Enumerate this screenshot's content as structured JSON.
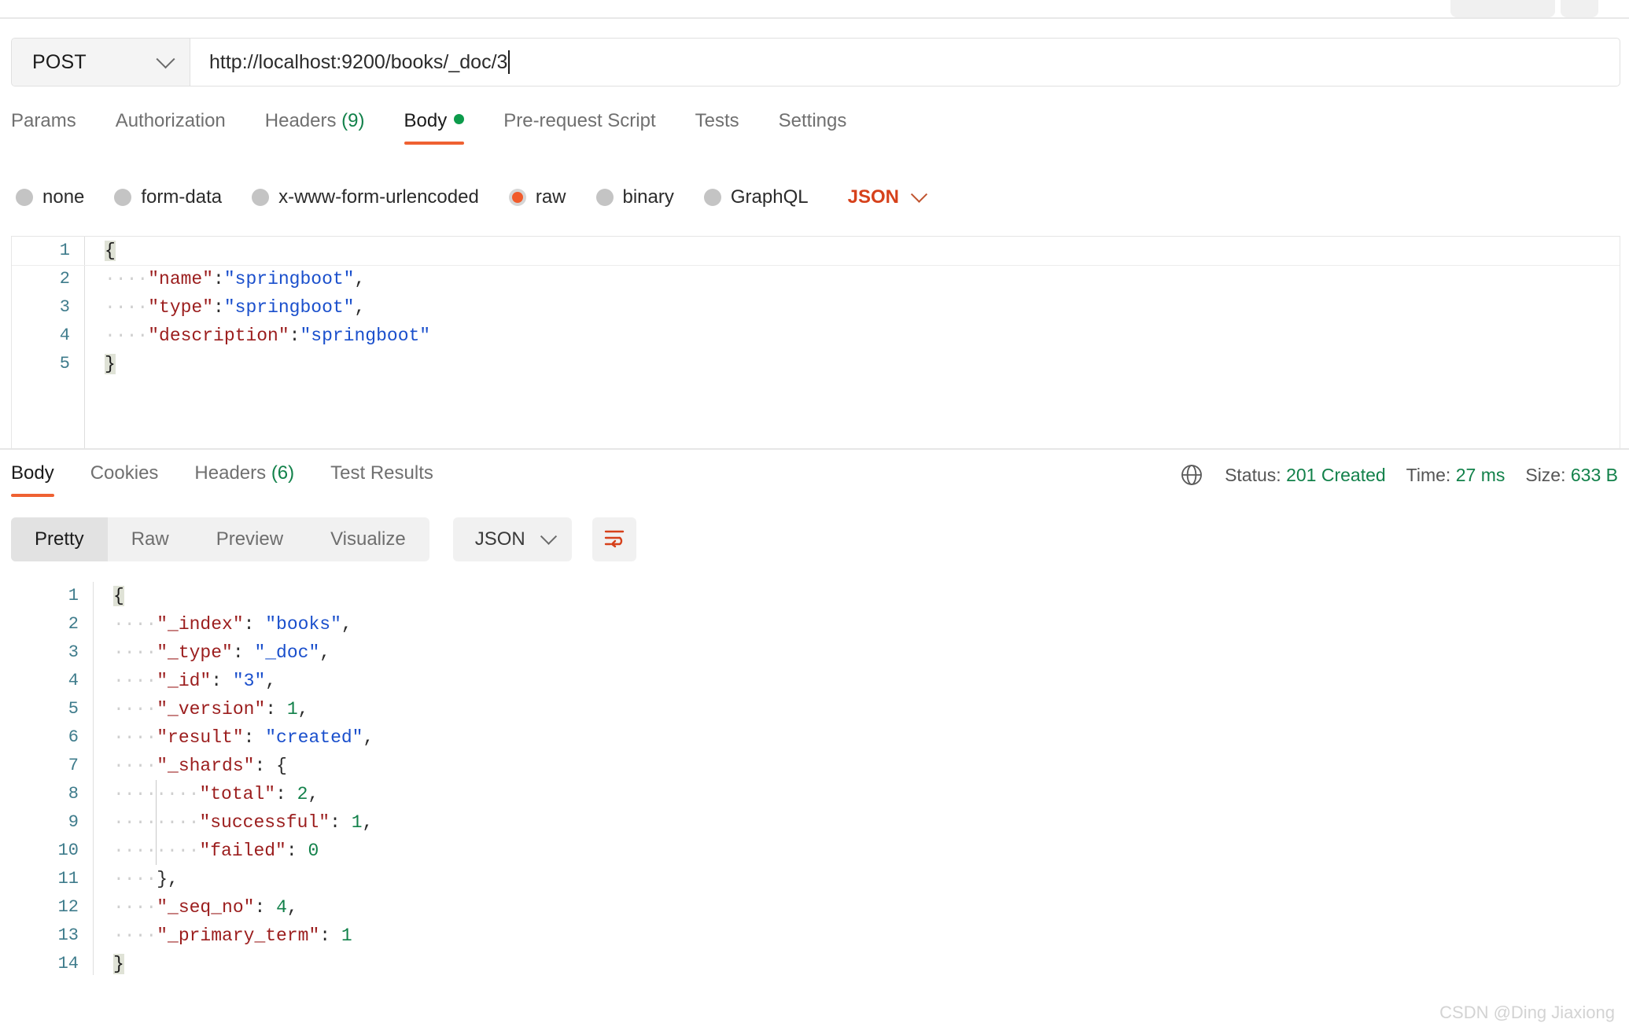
{
  "request": {
    "method": "POST",
    "url": "http://localhost:9200/books/_doc/3",
    "tabs": [
      {
        "label": "Params",
        "active": false
      },
      {
        "label": "Authorization",
        "active": false
      },
      {
        "label": "Headers",
        "count": "(9)",
        "active": false
      },
      {
        "label": "Body",
        "active": true,
        "dot": true
      },
      {
        "label": "Pre-request Script",
        "active": false
      },
      {
        "label": "Tests",
        "active": false
      },
      {
        "label": "Settings",
        "active": false
      }
    ],
    "body_modes": [
      {
        "label": "none",
        "selected": false
      },
      {
        "label": "form-data",
        "selected": false
      },
      {
        "label": "x-www-form-urlencoded",
        "selected": false
      },
      {
        "label": "raw",
        "selected": true
      },
      {
        "label": "binary",
        "selected": false
      },
      {
        "label": "GraphQL",
        "selected": false
      }
    ],
    "raw_format": "JSON",
    "body_lines": [
      {
        "n": "1",
        "text": "{"
      },
      {
        "n": "2",
        "text": "    \"name\":\"springboot\","
      },
      {
        "n": "3",
        "text": "    \"type\":\"springboot\","
      },
      {
        "n": "4",
        "text": "    \"description\":\"springboot\""
      },
      {
        "n": "5",
        "text": "}"
      }
    ]
  },
  "response": {
    "tabs": [
      {
        "label": "Body",
        "active": true
      },
      {
        "label": "Cookies",
        "active": false
      },
      {
        "label": "Headers",
        "count": "(6)",
        "active": false
      },
      {
        "label": "Test Results",
        "active": false
      }
    ],
    "status_label": "Status:",
    "status_value": "201 Created",
    "time_label": "Time:",
    "time_value": "27 ms",
    "size_label": "Size:",
    "size_value": "633 B",
    "views": [
      {
        "label": "Pretty",
        "active": true
      },
      {
        "label": "Raw",
        "active": false
      },
      {
        "label": "Preview",
        "active": false
      },
      {
        "label": "Visualize",
        "active": false
      }
    ],
    "format": "JSON",
    "body_lines": [
      {
        "n": "1",
        "text": "{"
      },
      {
        "n": "2",
        "text": "    \"_index\": \"books\","
      },
      {
        "n": "3",
        "text": "    \"_type\": \"_doc\","
      },
      {
        "n": "4",
        "text": "    \"_id\": \"3\","
      },
      {
        "n": "5",
        "text": "    \"_version\": 1,"
      },
      {
        "n": "6",
        "text": "    \"result\": \"created\","
      },
      {
        "n": "7",
        "text": "    \"_shards\": {"
      },
      {
        "n": "8",
        "text": "        \"total\": 2,"
      },
      {
        "n": "9",
        "text": "        \"successful\": 1,"
      },
      {
        "n": "10",
        "text": "        \"failed\": 0"
      },
      {
        "n": "11",
        "text": "    },"
      },
      {
        "n": "12",
        "text": "    \"_seq_no\": 4,"
      },
      {
        "n": "13",
        "text": "    \"_primary_term\": 1"
      },
      {
        "n": "14",
        "text": "}"
      }
    ]
  },
  "watermark": "CSDN @Ding Jiaxiong",
  "colors": {
    "accent": "#ef6132",
    "success": "#12814a",
    "json_key": "#9b1d1d",
    "json_string": "#1a4fcc",
    "json_number": "#12814a"
  }
}
